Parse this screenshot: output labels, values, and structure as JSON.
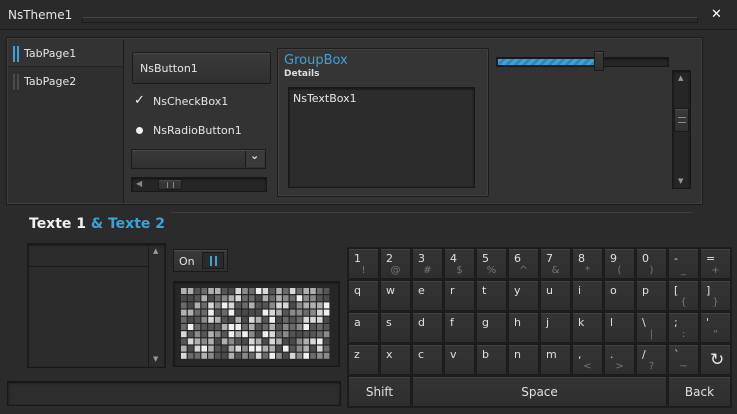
{
  "window": {
    "title": "NsTheme1",
    "close_glyph": "✕"
  },
  "tabs": [
    {
      "label": "TabPage1",
      "active": true
    },
    {
      "label": "TabPage2",
      "active": false
    }
  ],
  "controls": {
    "button_label": "NsButton1",
    "checkbox_label": "NsCheckBox1",
    "checkbox_checked": true,
    "radio_label": "NsRadioButton1",
    "radio_selected": true,
    "combo_value": "",
    "hscroll_value": 0.15
  },
  "groupbox": {
    "title": "GroupBox",
    "subtitle": "Details",
    "textbox_value": "NsTextBox1"
  },
  "progress": {
    "value": 0.6
  },
  "vscroll": {
    "value": 0.35
  },
  "label_part1": "Texte 1",
  "label_part2": "& Texte 2",
  "toggle": {
    "label": "On",
    "checked": true
  },
  "keyboard": {
    "row1": [
      {
        "m": "1",
        "s": "!"
      },
      {
        "m": "2",
        "s": "@"
      },
      {
        "m": "3",
        "s": "#"
      },
      {
        "m": "4",
        "s": "$"
      },
      {
        "m": "5",
        "s": "%"
      },
      {
        "m": "6",
        "s": "^"
      },
      {
        "m": "7",
        "s": "&"
      },
      {
        "m": "8",
        "s": "*"
      },
      {
        "m": "9",
        "s": "("
      },
      {
        "m": "0",
        "s": ")"
      },
      {
        "m": "-",
        "s": "_"
      },
      {
        "m": "=",
        "s": "+"
      }
    ],
    "row2": [
      {
        "m": "q",
        "s": ""
      },
      {
        "m": "w",
        "s": ""
      },
      {
        "m": "e",
        "s": ""
      },
      {
        "m": "r",
        "s": ""
      },
      {
        "m": "t",
        "s": ""
      },
      {
        "m": "y",
        "s": ""
      },
      {
        "m": "u",
        "s": ""
      },
      {
        "m": "i",
        "s": ""
      },
      {
        "m": "o",
        "s": ""
      },
      {
        "m": "p",
        "s": ""
      },
      {
        "m": "[",
        "s": "{"
      },
      {
        "m": "]",
        "s": "}"
      }
    ],
    "row3": [
      {
        "m": "a",
        "s": ""
      },
      {
        "m": "s",
        "s": ""
      },
      {
        "m": "d",
        "s": ""
      },
      {
        "m": "f",
        "s": ""
      },
      {
        "m": "g",
        "s": ""
      },
      {
        "m": "h",
        "s": ""
      },
      {
        "m": "j",
        "s": ""
      },
      {
        "m": "k",
        "s": ""
      },
      {
        "m": "l",
        "s": ""
      },
      {
        "m": "\\",
        "s": "|"
      },
      {
        "m": ";",
        "s": ":"
      },
      {
        "m": "'",
        "s": "\""
      }
    ],
    "row4": [
      {
        "m": "z",
        "s": ""
      },
      {
        "m": "x",
        "s": ""
      },
      {
        "m": "c",
        "s": ""
      },
      {
        "m": "v",
        "s": ""
      },
      {
        "m": "b",
        "s": ""
      },
      {
        "m": "n",
        "s": ""
      },
      {
        "m": "m",
        "s": ""
      },
      {
        "m": ",",
        "s": "<"
      },
      {
        "m": ".",
        "s": ">"
      },
      {
        "m": "/",
        "s": "?"
      },
      {
        "m": "`",
        "s": "~"
      },
      {
        "m": "",
        "s": "",
        "icon": "refresh-icon"
      }
    ],
    "shift_label": "Shift",
    "space_label": "Space",
    "back_label": "Back"
  },
  "colors": {
    "accent": "#3ba3d8",
    "background": "#2b2b2b",
    "panel": "#333333"
  }
}
